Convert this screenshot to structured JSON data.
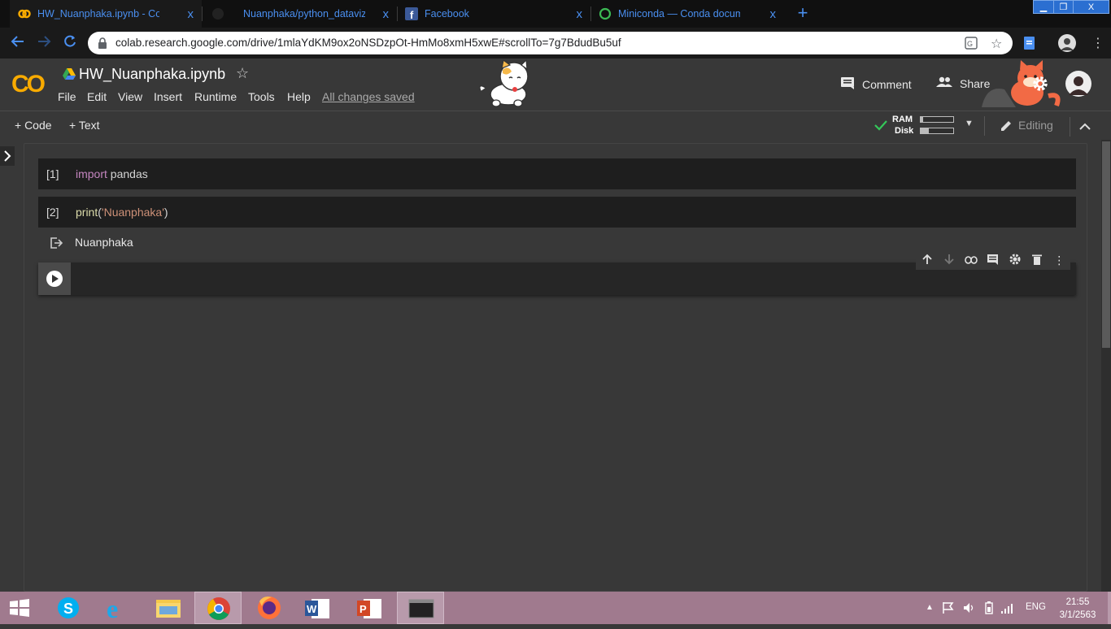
{
  "browser": {
    "tabs": [
      {
        "title": "HW_Nuanphaka.ipynb - Colabora",
        "icon": "colab-icon",
        "active": true
      },
      {
        "title": "Nuanphaka/python_dataviz",
        "icon": "github-icon",
        "active": false
      },
      {
        "title": "Facebook",
        "icon": "facebook-icon",
        "active": false
      },
      {
        "title": "Miniconda — Conda documentati",
        "icon": "loading-icon",
        "active": false
      }
    ],
    "new_tab": "+",
    "close": "x",
    "window_controls": {
      "minimize": "▁",
      "restore": "❐",
      "close": "X"
    },
    "url": "colab.research.google.com/drive/1mlaYdKM9ox2oNSDzpOt-HmMo8xmH5xwE#scrollTo=7g7BdudBu5uf"
  },
  "colab": {
    "logo": "CO",
    "title": "HW_Nuanphaka.ipynb",
    "menu": [
      "File",
      "Edit",
      "View",
      "Insert",
      "Runtime",
      "Tools",
      "Help"
    ],
    "save_status": "All changes saved",
    "comment_label": "Comment",
    "share_label": "Share",
    "add_code": "+ Code",
    "add_text": "+ Text",
    "ram_label": "RAM",
    "disk_label": "Disk",
    "editing_label": "Editing"
  },
  "cells": [
    {
      "count": "[1]",
      "code_parts": [
        {
          "t": "import",
          "c": "kw"
        },
        {
          "t": " pandas",
          "c": ""
        }
      ]
    },
    {
      "count": "[2]",
      "code_parts": [
        {
          "t": "print",
          "c": "fn"
        },
        {
          "t": "(",
          "c": ""
        },
        {
          "t": "'Nuanphaka'",
          "c": "str"
        },
        {
          "t": ")",
          "c": ""
        }
      ]
    }
  ],
  "output": "Nuanphaka",
  "taskbar": {
    "language": "ENG",
    "time": "21:55",
    "date": "3/1/2563"
  },
  "colors": {
    "accent_blue": "#4a8ff0",
    "colab_orange": "#f9ab00",
    "taskbar": "#a07a8e"
  }
}
